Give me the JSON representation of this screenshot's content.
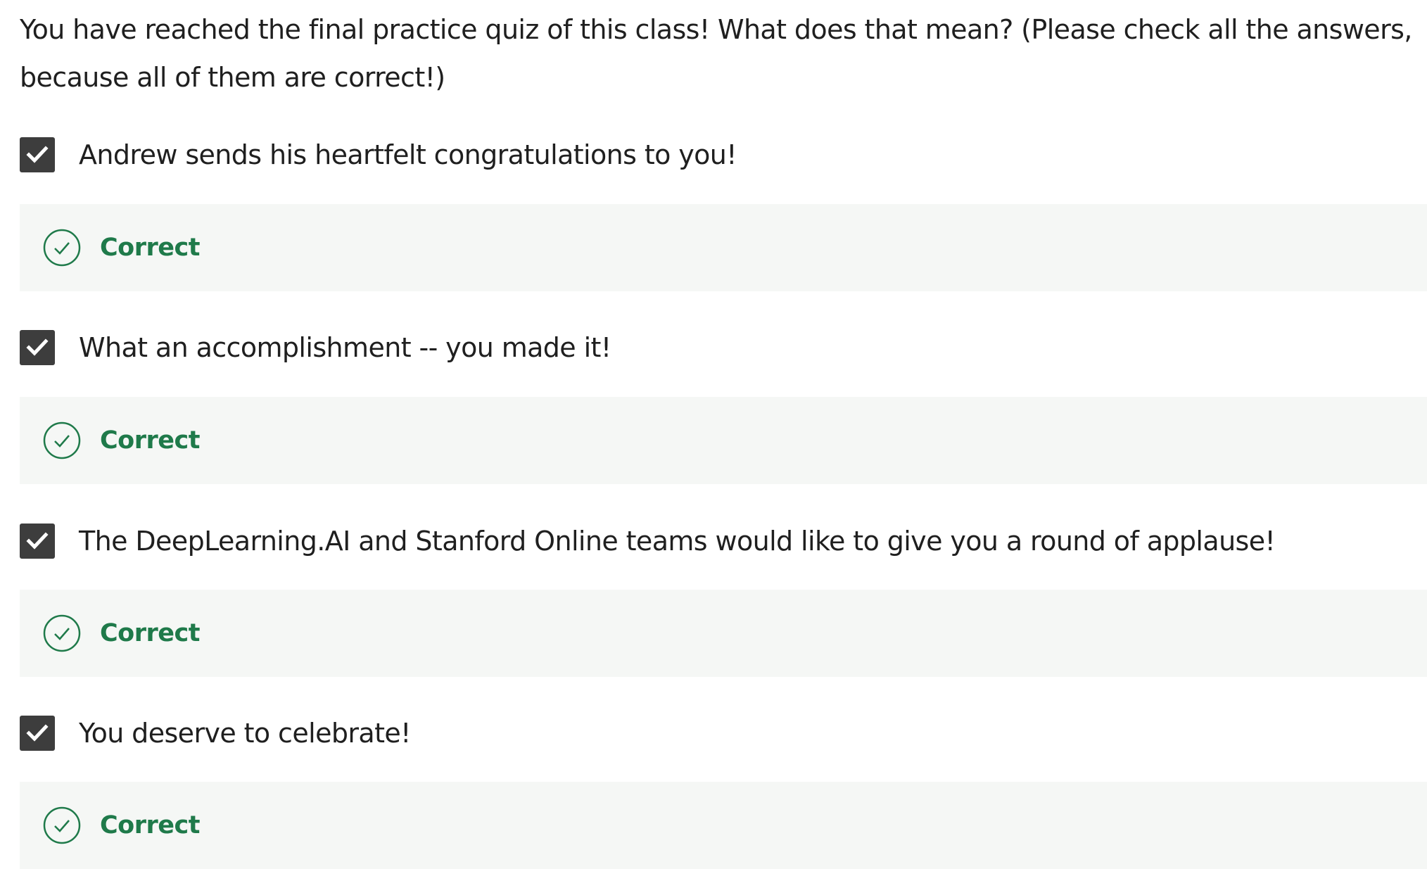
{
  "question": {
    "text": "You have reached the final practice quiz of this class! What does that mean? (Please check all the answers, because all of them are correct!)"
  },
  "colors": {
    "checkbox_fill": "#3d3d3d",
    "feedback_bg": "#f5f7f5",
    "correct_green": "#1f7a4a"
  },
  "options": [
    {
      "label": "Andrew sends his heartfelt congratulations to you!",
      "checked": true,
      "feedback": "Correct",
      "icon": "check-circle-icon"
    },
    {
      "label": "What an accomplishment -- you made it!",
      "checked": true,
      "feedback": "Correct",
      "icon": "check-circle-icon"
    },
    {
      "label": "The DeepLearning.AI and Stanford Online teams would like to give you a round of applause!",
      "checked": true,
      "feedback": "Correct",
      "icon": "check-circle-icon"
    },
    {
      "label": "You deserve to celebrate!",
      "checked": true,
      "feedback": "Correct",
      "icon": "check-circle-icon"
    }
  ]
}
